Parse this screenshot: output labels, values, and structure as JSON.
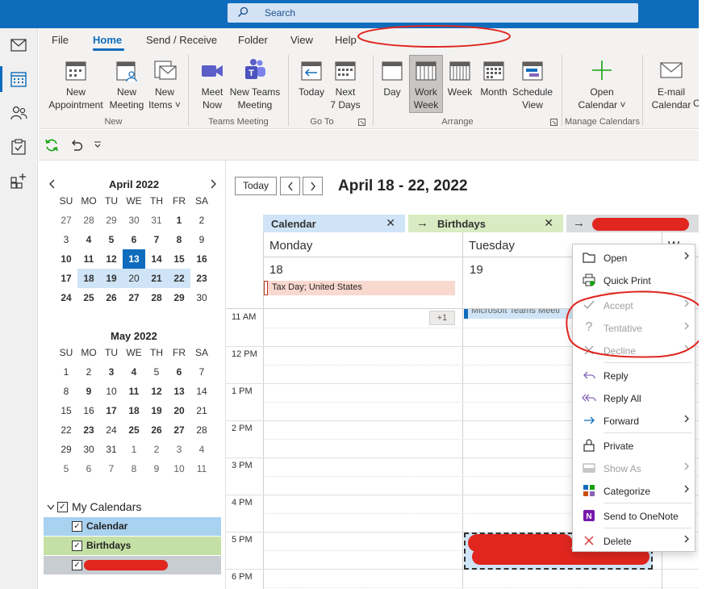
{
  "search": {
    "placeholder": "Search"
  },
  "menu": {
    "tabs": [
      "File",
      "Home",
      "Send / Receive",
      "Folder",
      "View",
      "Help"
    ],
    "active": "Home"
  },
  "ribbon": {
    "new_appointment": [
      "New",
      "Appointment"
    ],
    "new_meeting": [
      "New",
      "Meeting"
    ],
    "new_items": [
      "New",
      "Items ˅"
    ],
    "meet_now": [
      "Meet",
      "Now"
    ],
    "new_teams_meeting": [
      "New Teams",
      "Meeting"
    ],
    "today": [
      "Today",
      ""
    ],
    "next7": [
      "Next",
      "7 Days"
    ],
    "day": [
      "Day",
      ""
    ],
    "work_week": [
      "Work",
      "Week"
    ],
    "week": [
      "Week",
      ""
    ],
    "month": [
      "Month",
      ""
    ],
    "schedule_view": [
      "Schedule",
      "View"
    ],
    "open_calendar": [
      "Open",
      "Calendar ˅"
    ],
    "email_calendar": [
      "E-mail",
      "Calendar"
    ],
    "extra": [
      "",
      "C"
    ],
    "groups": {
      "new": "New",
      "teams": "Teams Meeting",
      "goto": "Go To",
      "arrange": "Arrange",
      "manage": "Manage Calendars"
    }
  },
  "april": {
    "title": "April 2022",
    "headers": [
      "SU",
      "MO",
      "TU",
      "WE",
      "TH",
      "FR",
      "SA"
    ],
    "days": [
      "27",
      "28",
      "29",
      "30",
      "31",
      "1",
      "2",
      "3",
      "4",
      "5",
      "6",
      "7",
      "8",
      "9",
      "10",
      "11",
      "12",
      "13",
      "14",
      "15",
      "16",
      "17",
      "18",
      "19",
      "20",
      "21",
      "22",
      "23",
      "24",
      "25",
      "26",
      "27",
      "28",
      "29",
      "30"
    ]
  },
  "may": {
    "title": "May 2022",
    "headers": [
      "SU",
      "MO",
      "TU",
      "WE",
      "TH",
      "FR",
      "SA"
    ],
    "days": [
      "1",
      "2",
      "3",
      "4",
      "5",
      "6",
      "7",
      "8",
      "9",
      "10",
      "11",
      "12",
      "13",
      "14",
      "15",
      "16",
      "17",
      "18",
      "19",
      "20",
      "21",
      "22",
      "23",
      "24",
      "25",
      "26",
      "27",
      "28",
      "29",
      "30",
      "31",
      "1",
      "2",
      "3",
      "4",
      "5",
      "6",
      "7",
      "8",
      "9",
      "10",
      "11"
    ]
  },
  "my_calendars": {
    "title": "My Calendars",
    "items": [
      "Calendar",
      "Birthdays",
      ""
    ],
    "colors": [
      "#a9d1f0",
      "#c5e0a5",
      "#c8cdd2"
    ]
  },
  "main": {
    "today_btn": "Today",
    "range": "April 18 - 22, 2022",
    "tabs": [
      "Calendar",
      "Birthdays",
      ""
    ],
    "days": [
      {
        "name": "Monday",
        "num": "18"
      },
      {
        "name": "Tuesday",
        "num": "19"
      },
      {
        "name": "W",
        "num": ""
      }
    ],
    "holiday": "Tax Day; United States",
    "plus_more": "+1",
    "teams_event": "Microsoft Teams Meeti",
    "times": [
      "11 AM",
      "12 PM",
      "1 PM",
      "2 PM",
      "3 PM",
      "4 PM",
      "5 PM",
      "6 PM"
    ]
  },
  "context_menu": {
    "items": [
      {
        "label": "Open",
        "sub": true,
        "disabled": false,
        "icon": "open-icon"
      },
      {
        "label": "Quick Print",
        "sub": false,
        "disabled": false,
        "icon": "quick-print-icon"
      },
      {
        "label": "Accept",
        "sub": true,
        "disabled": true,
        "icon": "checkmark-icon"
      },
      {
        "label": "Tentative",
        "sub": true,
        "disabled": true,
        "icon": "question-icon"
      },
      {
        "label": "Decline",
        "sub": true,
        "disabled": true,
        "icon": "x-icon"
      },
      {
        "label": "Reply",
        "sub": false,
        "disabled": false,
        "icon": "reply-icon"
      },
      {
        "label": "Reply All",
        "sub": false,
        "disabled": false,
        "icon": "reply-all-icon"
      },
      {
        "label": "Forward",
        "sub": true,
        "disabled": false,
        "icon": "forward-icon"
      },
      {
        "label": "Private",
        "sub": false,
        "disabled": false,
        "icon": "lock-icon"
      },
      {
        "label": "Show As",
        "sub": true,
        "disabled": true,
        "icon": "show-as-icon"
      },
      {
        "label": "Categorize",
        "sub": true,
        "disabled": false,
        "icon": "categorize-icon"
      },
      {
        "label": "Send to OneNote",
        "sub": false,
        "disabled": false,
        "icon": "onenote-icon"
      },
      {
        "label": "Delete",
        "sub": true,
        "disabled": false,
        "icon": "delete-icon"
      }
    ]
  }
}
